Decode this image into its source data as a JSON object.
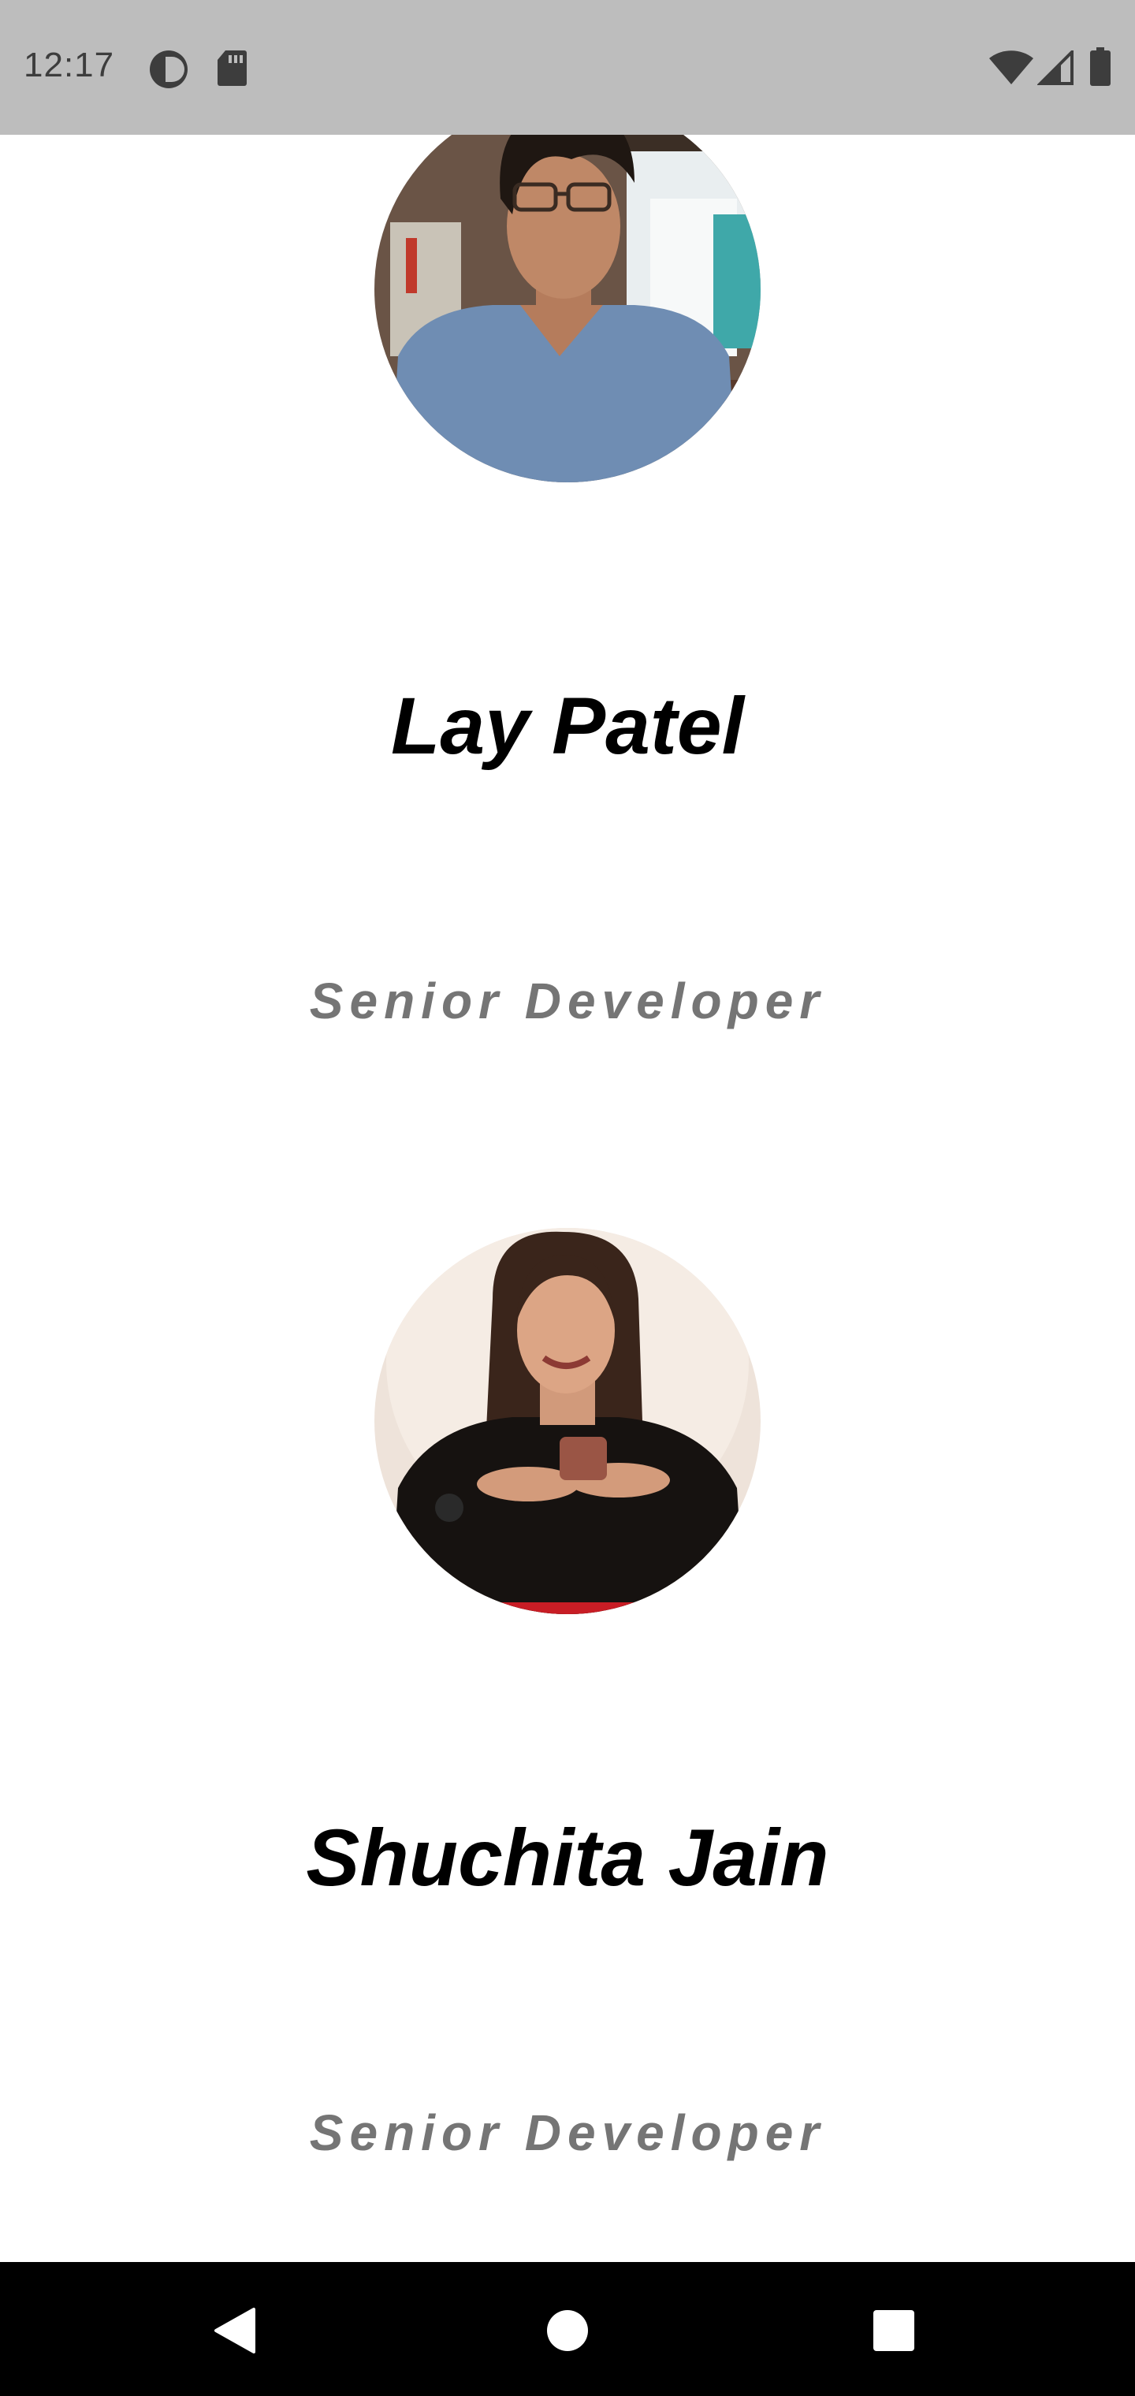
{
  "status_bar": {
    "time": "12:17",
    "icons": [
      "data-saver-icon",
      "sd-card-icon",
      "wifi-icon",
      "signal-icon",
      "battery-icon"
    ]
  },
  "team": [
    {
      "name": "Lay Patel",
      "role": "Senior Developer",
      "avatar_icon": "profile-photo"
    },
    {
      "name": "Shuchita Jain",
      "role": "Senior Developer",
      "avatar_icon": "profile-photo"
    }
  ],
  "nav_bar": {
    "buttons": [
      "back-icon",
      "home-icon",
      "recents-icon"
    ]
  },
  "colors": {
    "status_bar_bg": "#bdbdbd",
    "name_text": "#000000",
    "role_text": "#757575",
    "nav_bar_bg": "#000000"
  }
}
